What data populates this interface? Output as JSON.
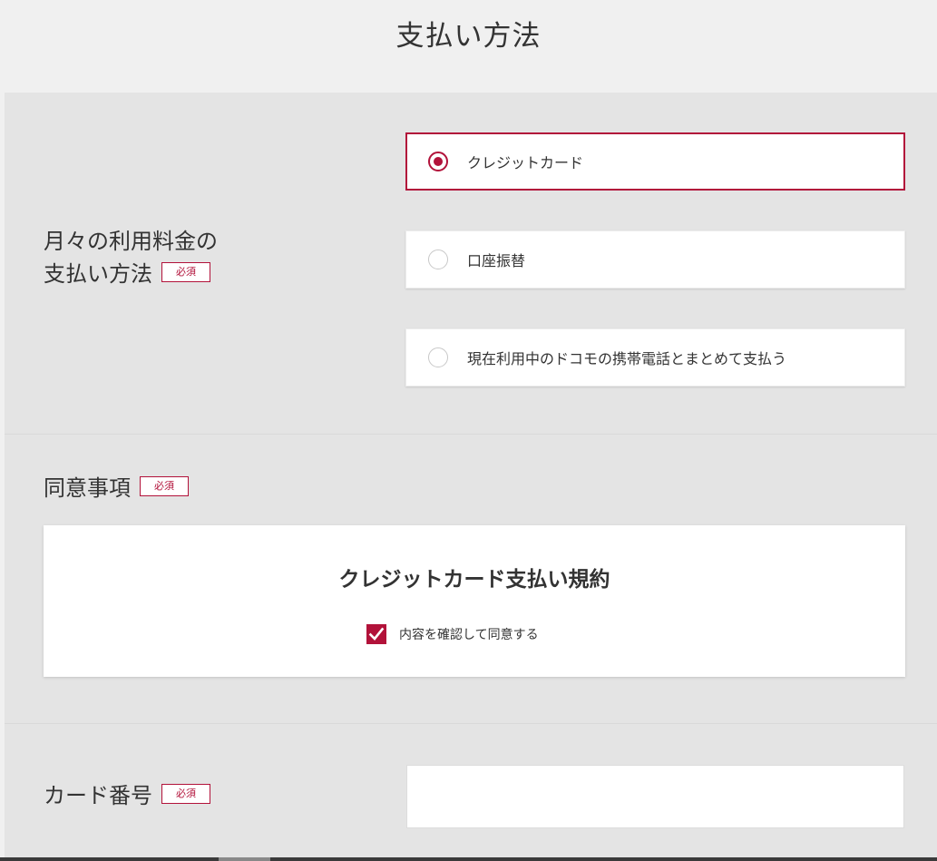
{
  "page": {
    "title": "支払い方法"
  },
  "payment_method": {
    "label_line1": "月々の利用料金の",
    "label_line2": "支払い方法",
    "required": "必須",
    "options": [
      {
        "label": "クレジットカード",
        "selected": true
      },
      {
        "label": "口座振替",
        "selected": false
      },
      {
        "label": "現在利用中のドコモの携帯電話とまとめて支払う",
        "selected": false
      }
    ]
  },
  "consent": {
    "label": "同意事項",
    "required": "必須",
    "terms_title": "クレジットカード支払い規約",
    "agree_label": "内容を確認して同意する",
    "agreed": true
  },
  "card_number": {
    "label": "カード番号",
    "required": "必須",
    "value": "",
    "placeholder": ""
  },
  "colors": {
    "accent": "#b2123a",
    "background": "#e4e4e4",
    "title_band": "#f0f0f0"
  },
  "icons": {
    "selected_radio": "radio-selected-icon",
    "unselected_radio": "radio-unselected-icon",
    "checkbox": "checkmark-icon"
  }
}
